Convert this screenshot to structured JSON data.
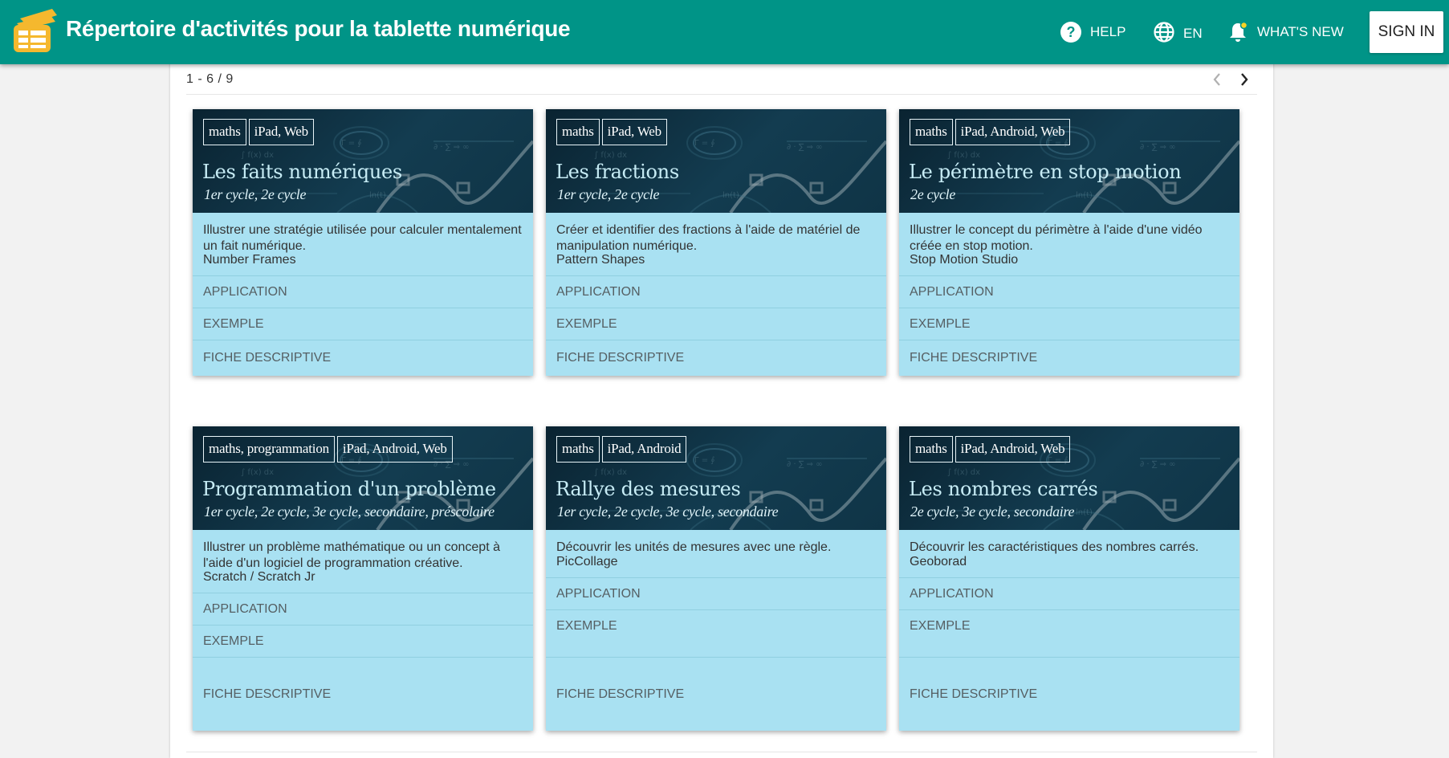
{
  "header": {
    "title": "Répertoire d'activités pour la tablette numérique",
    "logo_icon": "stack-of-cards-logo",
    "help_label": "HELP",
    "lang_label": "EN",
    "whats_new_label": "WHAT'S NEW",
    "sign_in_label": "SIGN IN",
    "colors": {
      "bar": "#009487",
      "logo": "#f5b82e",
      "notify_dot": "#f9d423"
    }
  },
  "pager": {
    "label": "1 - 6 / 9"
  },
  "card_style": {
    "body": "#a9e1f2",
    "header": "#0f3446",
    "title": "#c7ecf5"
  },
  "cards": [
    {
      "tags": [
        "maths",
        "iPad, Web"
      ],
      "title": "Les faits numériques",
      "cycles": "1er cycle, 2e cycle",
      "description": "Illustrer une stratégie utilisée pour calculer mentalement un fait numérique.",
      "app": "Number Frames",
      "links": [
        "APPLICATION",
        "EXEMPLE",
        "FICHE DESCRIPTIVE"
      ]
    },
    {
      "tags": [
        "maths",
        "iPad, Web"
      ],
      "title": "Les fractions",
      "cycles": "1er cycle, 2e cycle",
      "description": "Créer et identifier des fractions à l'aide de matériel de manipulation numérique.",
      "app": "Pattern Shapes",
      "links": [
        "APPLICATION",
        "EXEMPLE",
        "FICHE DESCRIPTIVE"
      ]
    },
    {
      "tags": [
        "maths",
        "iPad, Android, Web"
      ],
      "title": "Le périmètre en stop motion",
      "cycles": "2e cycle",
      "description": "Illustrer le concept du périmètre à l'aide d'une vidéo créée en stop motion.",
      "app": "Stop Motion Studio",
      "links": [
        "APPLICATION",
        "EXEMPLE",
        "FICHE DESCRIPTIVE"
      ]
    },
    {
      "tags": [
        "maths, programmation",
        "iPad, Android, Web"
      ],
      "title": "Programmation d'un problème",
      "cycles": "1er cycle, 2e cycle, 3e cycle, secondaire, préscolaire",
      "description": "Illustrer un problème mathématique ou un concept à l'aide d'un logiciel de programmation créative.",
      "app": "Scratch / Scratch Jr",
      "links": [
        "APPLICATION",
        "EXEMPLE",
        "FICHE DESCRIPTIVE"
      ]
    },
    {
      "tags": [
        "maths",
        "iPad, Android"
      ],
      "title": "Rallye des mesures",
      "cycles": "1er cycle, 2e cycle, 3e cycle, secondaire",
      "description": "Découvrir les unités de mesures avec une règle.",
      "app": "PicCollage",
      "links": [
        "APPLICATION",
        "EXEMPLE",
        "FICHE DESCRIPTIVE"
      ]
    },
    {
      "tags": [
        "maths",
        "iPad, Android, Web"
      ],
      "title": "Les nombres carrés",
      "cycles": "2e cycle, 3e cycle, secondaire",
      "description": "Découvrir les caractéristiques des nombres carrés.",
      "app": "Geoborad",
      "links": [
        "APPLICATION",
        "EXEMPLE",
        "FICHE DESCRIPTIVE"
      ]
    }
  ]
}
